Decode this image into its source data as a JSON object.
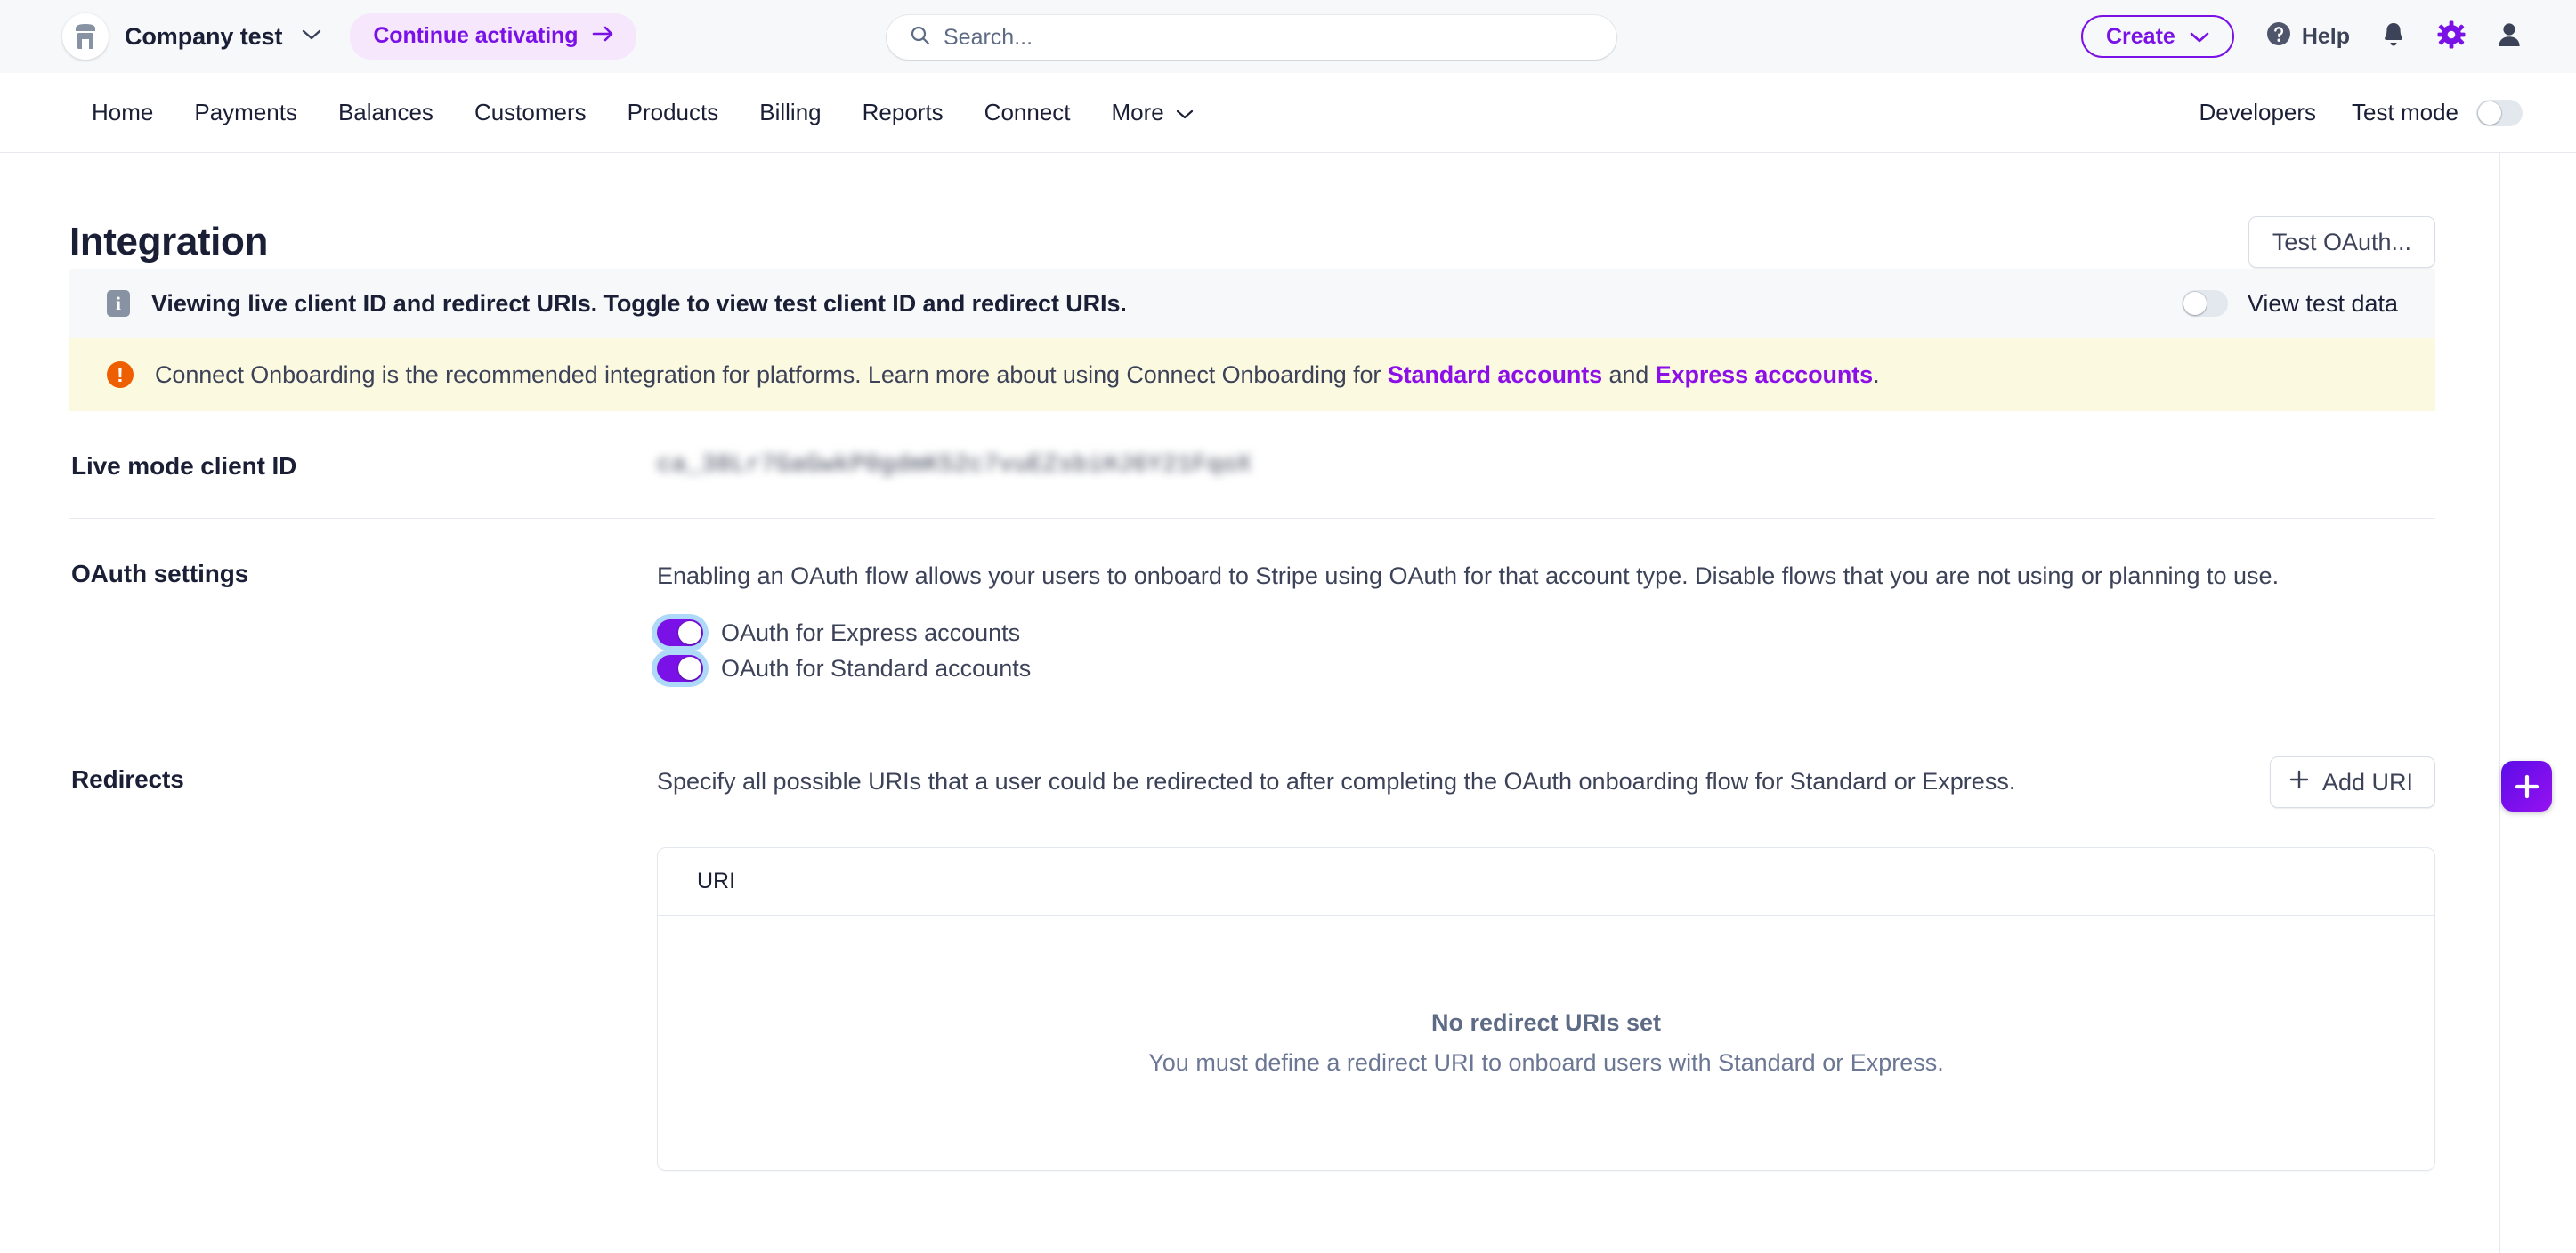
{
  "colors": {
    "brand_purple": "#7a11e6",
    "link_purple": "#8c0fe8",
    "warn_orange": "#ed5f00",
    "info_gray": "#8792a2",
    "banner_info_bg": "#f6f8fa",
    "banner_warn_bg": "#fcf9e1",
    "text_dark": "#1a1f36"
  },
  "topbar": {
    "account_name": "Company test",
    "account_caret": "chevron-down",
    "activate_label": "Continue activating",
    "activate_arrow": "→",
    "search_placeholder": "Search...",
    "search_value": "",
    "create_label": "Create",
    "help_label": "Help",
    "icons": [
      "notifications-bell",
      "settings-gear",
      "user-avatar"
    ]
  },
  "nav": {
    "items": [
      {
        "label": "Home"
      },
      {
        "label": "Payments"
      },
      {
        "label": "Balances"
      },
      {
        "label": "Customers"
      },
      {
        "label": "Products"
      },
      {
        "label": "Billing"
      },
      {
        "label": "Reports"
      },
      {
        "label": "Connect"
      },
      {
        "label": "More"
      }
    ],
    "developers_label": "Developers",
    "test_mode_label": "Test mode",
    "test_mode_on": false
  },
  "page": {
    "title": "Integration",
    "test_oauth_label": "Test OAuth..."
  },
  "info_banner": {
    "icon": "info-icon",
    "message": "Viewing live client ID and redirect URIs. Toggle to view test client ID and redirect URIs.",
    "toggle_label": "View test data",
    "toggle_on": false
  },
  "warn_banner": {
    "icon": "warning-icon",
    "text_before": "Connect Onboarding is the recommended integration for platforms. Learn more about using Connect Onboarding for ",
    "link_1": "Standard accounts",
    "text_middle": " and ",
    "link_2": "Express acccounts",
    "text_after": "."
  },
  "client_id": {
    "label": "Live mode client ID",
    "value": "ca_38Lr7GaGwkP0gdmK52c7vuEZsbiHJ6Y21FqoX",
    "redacted": true
  },
  "oauth_settings": {
    "label": "OAuth settings",
    "description": "Enabling an OAuth flow allows your users to onboard to Stripe using OAuth for that account type. Disable flows that you are not using or planning to use.",
    "toggles": [
      {
        "label": "OAuth for Express accounts",
        "on": true
      },
      {
        "label": "OAuth for Standard accounts",
        "on": true
      }
    ]
  },
  "redirects": {
    "label": "Redirects",
    "description": "Specify all possible URIs that a user could be redirected to after completing the OAuth onboarding flow for Standard or Express.",
    "add_button_label": "Add URI",
    "add_button_icon": "plus-icon",
    "table": {
      "columns": [
        "URI"
      ],
      "rows": [],
      "empty_title": "No redirect URIs set",
      "empty_subtitle": "You must define a redirect URI to onboard users with Standard or Express."
    }
  },
  "fab": {
    "icon": "plus-icon",
    "label": ""
  }
}
